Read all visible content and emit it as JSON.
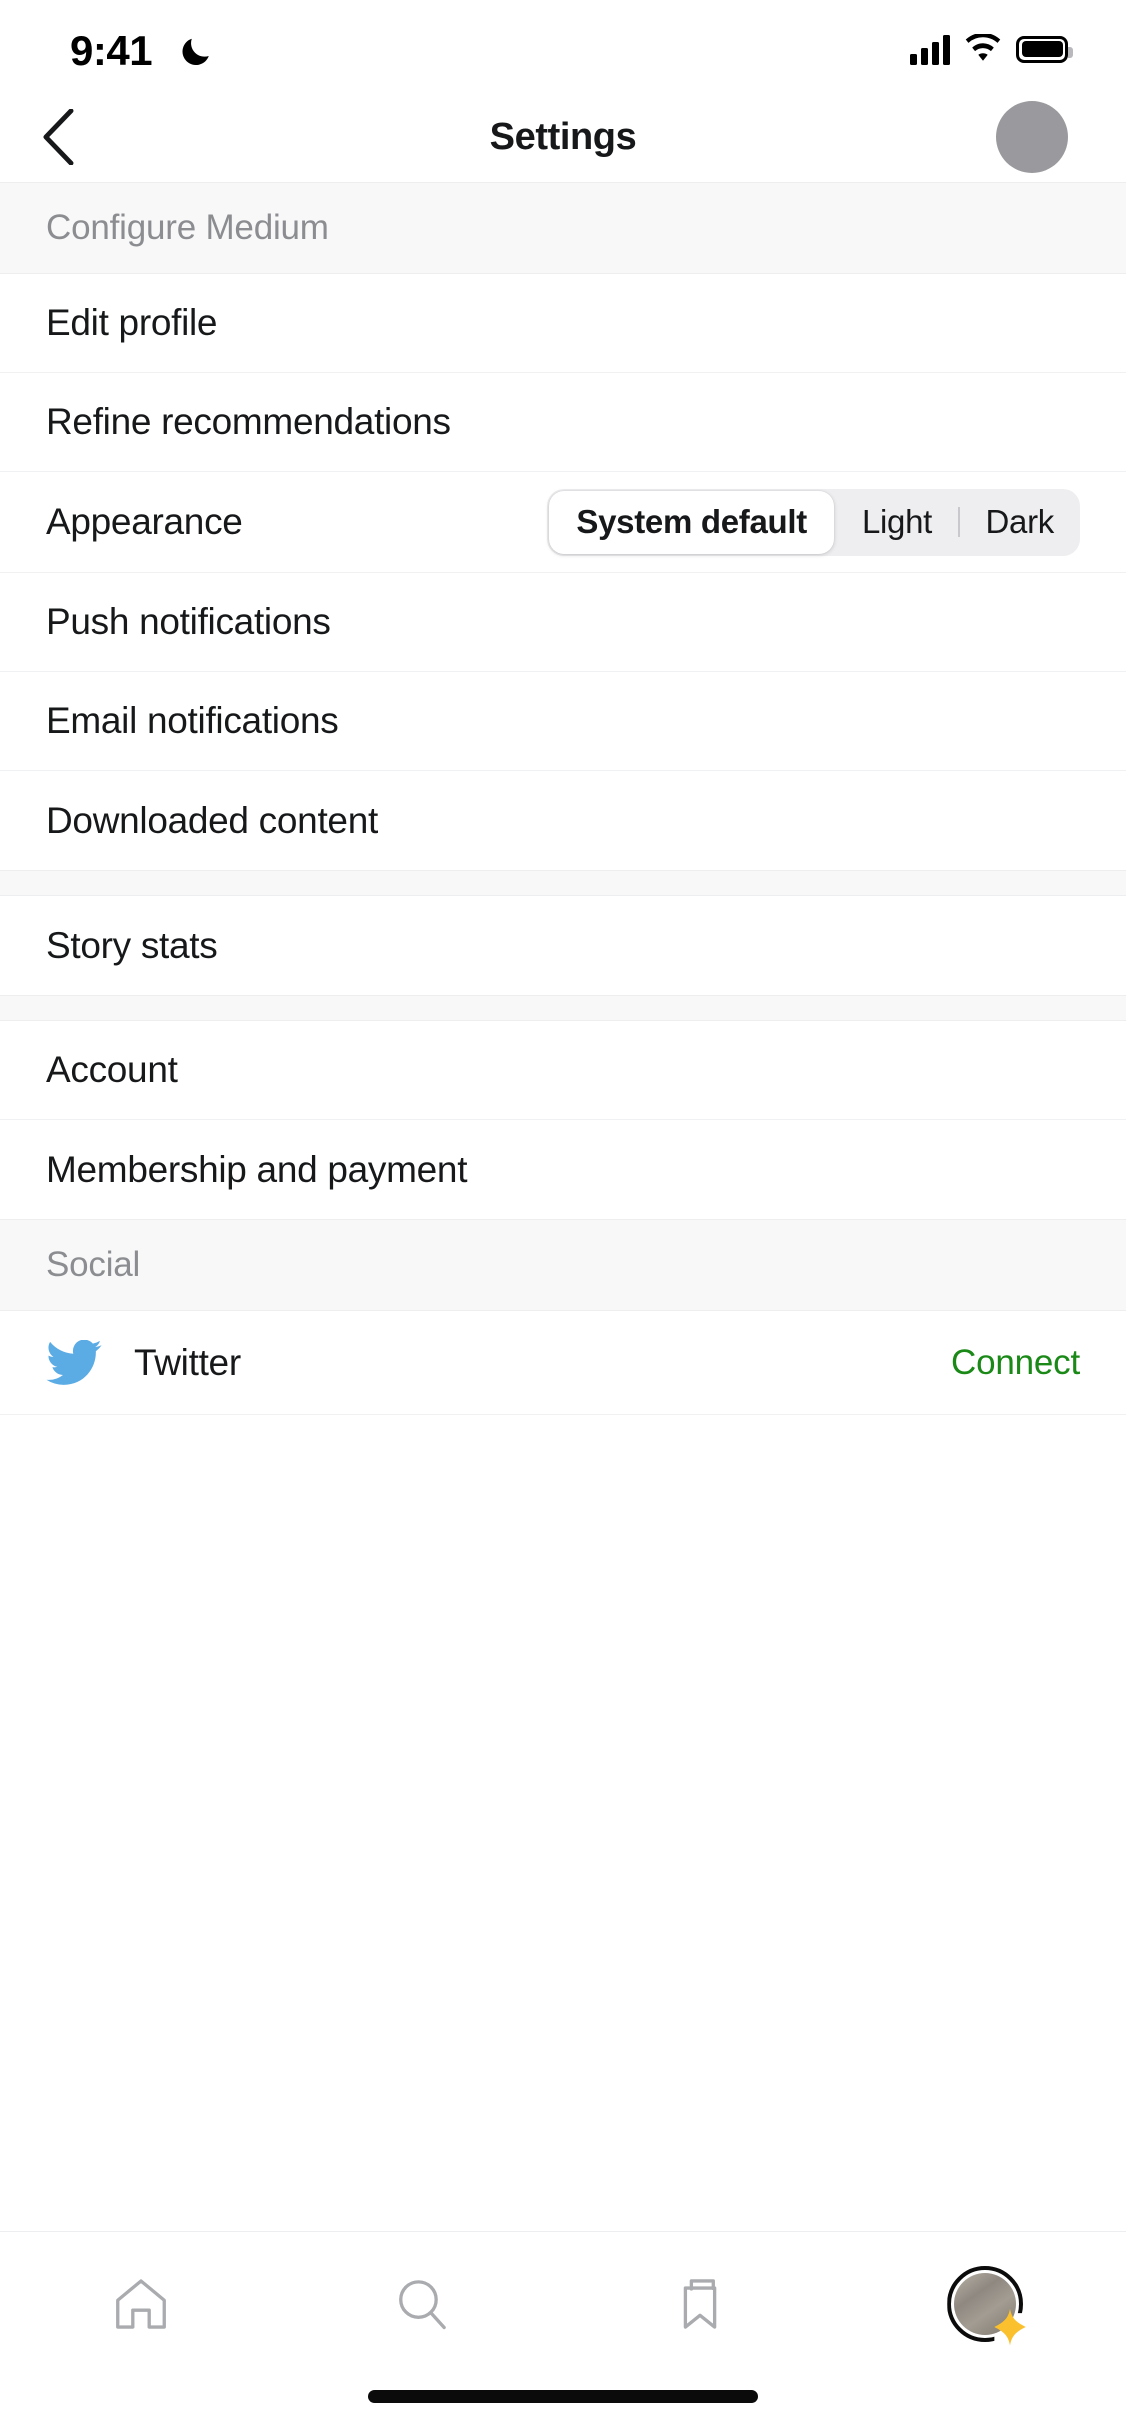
{
  "status_bar": {
    "time": "9:41",
    "dnd_icon": "moon-icon",
    "signal_icon": "cellular-signal-icon",
    "wifi_icon": "wifi-icon",
    "battery_icon": "battery-full-icon"
  },
  "header": {
    "back_icon": "chevron-left-icon",
    "title": "Settings",
    "avatar": "user-avatar"
  },
  "sections": [
    {
      "header": "Configure Medium",
      "rows": [
        {
          "label": "Edit profile",
          "type": "link"
        },
        {
          "label": "Refine recommendations",
          "type": "link"
        },
        {
          "label": "Appearance",
          "type": "segmented"
        },
        {
          "label": "Push notifications",
          "type": "link"
        },
        {
          "label": "Email notifications",
          "type": "link"
        },
        {
          "label": "Downloaded content",
          "type": "link"
        }
      ]
    },
    {
      "header": "",
      "rows": [
        {
          "label": "Story stats",
          "type": "link"
        }
      ]
    },
    {
      "header": "",
      "rows": [
        {
          "label": "Account",
          "type": "link"
        },
        {
          "label": "Membership and payment",
          "type": "link"
        }
      ]
    },
    {
      "header": "Social",
      "rows": [
        {
          "label": "Twitter",
          "type": "social",
          "icon": "twitter-icon",
          "action": "Connect"
        }
      ]
    }
  ],
  "appearance": {
    "label": "Appearance",
    "options": [
      "System default",
      "Light",
      "Dark"
    ],
    "selected": "System default"
  },
  "social": {
    "twitter_label": "Twitter",
    "connect_label": "Connect",
    "twitter_icon": "twitter-icon"
  },
  "tabbar": {
    "items": [
      {
        "name": "home-icon",
        "label": "Home"
      },
      {
        "name": "search-icon",
        "label": "Search"
      },
      {
        "name": "bookmark-icon",
        "label": "Bookmarks"
      },
      {
        "name": "profile-avatar-icon",
        "label": "Profile"
      }
    ]
  },
  "colors": {
    "accent_green": "#1a8917",
    "twitter_blue": "#5babe5",
    "star_gold": "#fbc02d",
    "text_primary": "#16181a",
    "text_muted": "#8b8d90",
    "section_bg": "#f8f8f9",
    "segment_track": "#eeeef0"
  }
}
